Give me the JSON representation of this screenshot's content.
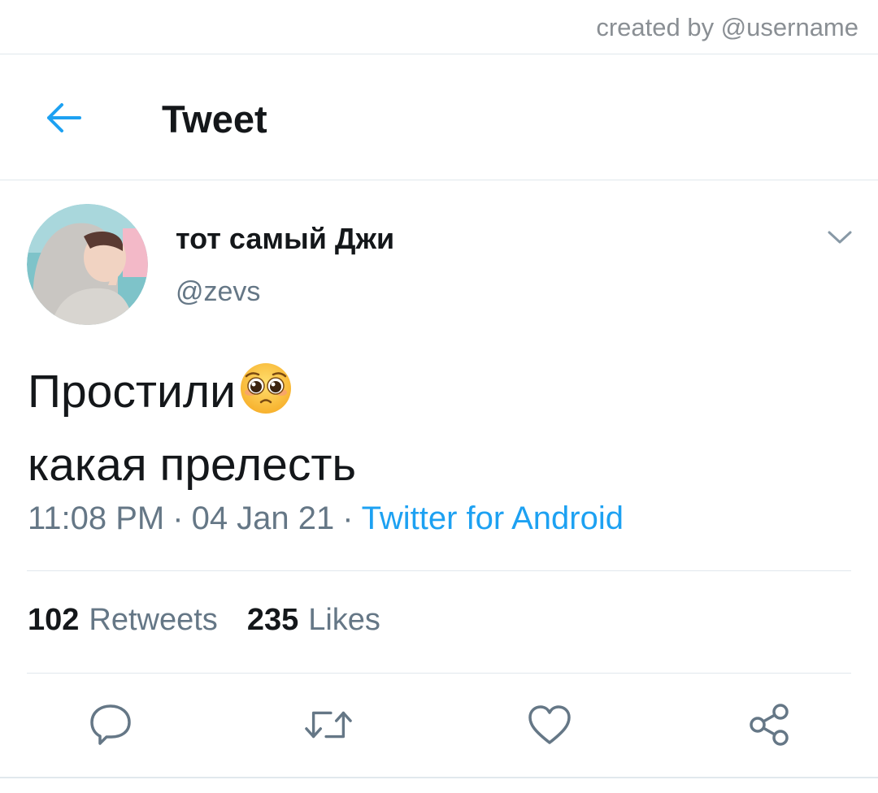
{
  "watermark": "created by @username",
  "header": {
    "title": "Tweet",
    "back_icon": "arrow-left-icon"
  },
  "tweet": {
    "author": {
      "display_name": "тот самый Джи",
      "handle": "@zevs"
    },
    "text_line_1": "Простили",
    "emoji": "pleading-face-emoji",
    "text_line_2": "какая прелесть",
    "time": "11:08 PM",
    "date": "04 Jan 21",
    "separator": "·",
    "source": "Twitter for Android",
    "retweets_count": "102",
    "retweets_label": "Retweets",
    "likes_count": "235",
    "likes_label": "Likes"
  },
  "actions": [
    "reply-icon",
    "retweet-icon",
    "like-icon",
    "share-icon"
  ],
  "colors": {
    "accent": "#1da1f2",
    "text_primary": "#14171a",
    "text_secondary": "#657786",
    "divider": "#e1e8ed"
  }
}
